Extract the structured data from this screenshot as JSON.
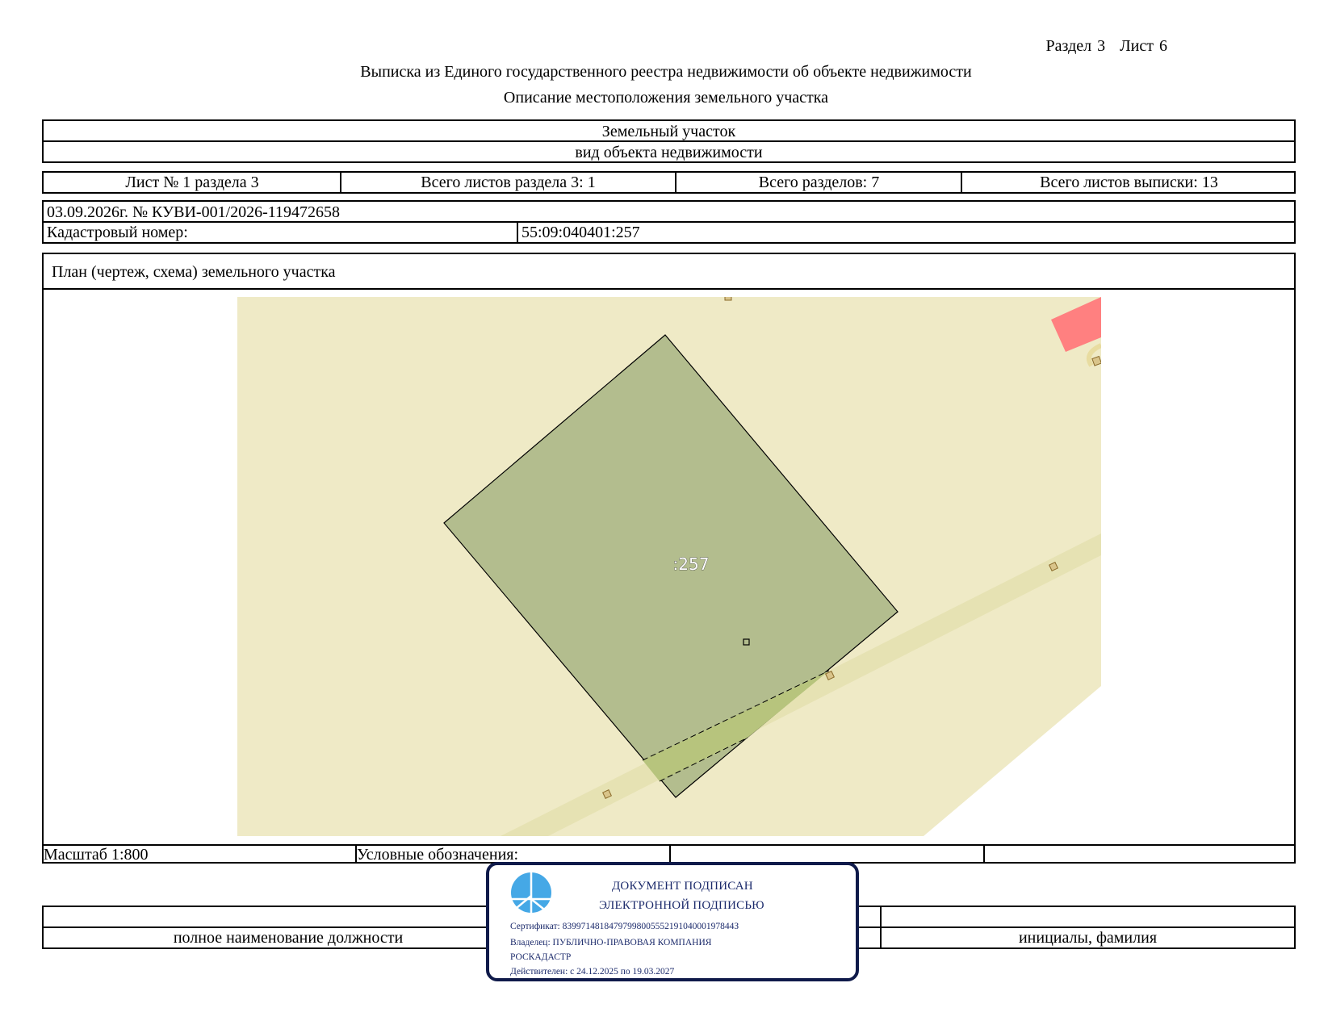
{
  "header": {
    "section_label": "Раздел 3",
    "sheet_label": "Лист 6",
    "title": "Выписка из Единого государственного реестра недвижимости об объекте недвижимости",
    "subtitle": "Описание местоположения земельного участка"
  },
  "object": {
    "type_value": "Земельный участок",
    "type_caption": "вид объекта недвижимости"
  },
  "sheet_info": {
    "sheet_no": "Лист № 1 раздела 3",
    "section_sheets": "Всего листов раздела 3: 1",
    "sections_total": "Всего разделов: 7",
    "extract_sheets": "Всего листов выписки: 13"
  },
  "record": {
    "date_number": "03.09.2026г. № КУВИ-001/2026-119472658",
    "cadastral_label": "Кадастровый номер:",
    "cadastral_number": "55:09:040401:257"
  },
  "plan": {
    "title": "План (чертеж, схема) земельного участка",
    "parcel_label": ":257",
    "colors": {
      "background": "#efeac6",
      "parcel_fill": "#b3bd8e",
      "road": "#e6e2b3",
      "overlap": "#b7c47d",
      "building": "#ff8080",
      "marker": "#d9c48a"
    }
  },
  "legend": {
    "scale": "Масштаб 1:800",
    "legend_label": "Условные обозначения:"
  },
  "signature": {
    "position_caption": "полное наименование должности",
    "name_caption": "инициалы, фамилия"
  },
  "stamp": {
    "line1": "ДОКУМЕНТ ПОДПИСАН",
    "line2": "ЭЛЕКТРОННОЙ ПОДПИСЬЮ",
    "certificate": "Сертификат: 8399714818479799800555219104000197844З",
    "owner_line1": "Владелец: ПУБЛИЧНО-ПРАВОВАЯ КОМПАНИЯ",
    "owner_line2": "РОСКАДАСТР",
    "valid": "Действителен: с 24.12.2025 по 19.03.2027",
    "emblem": "roskadastr-emblem-icon"
  }
}
